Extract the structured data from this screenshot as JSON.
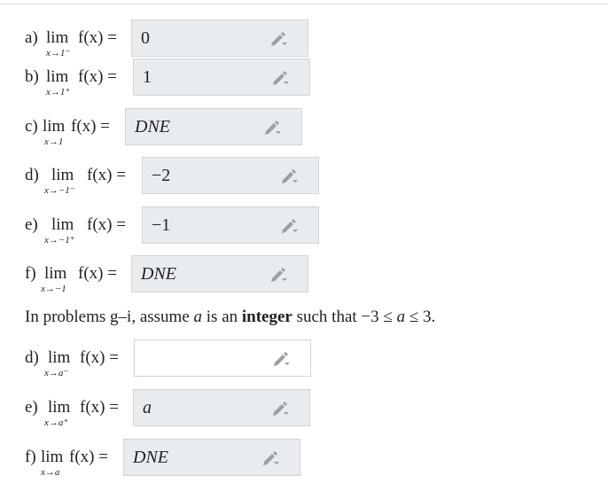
{
  "problems": [
    {
      "label": "a)",
      "lim": "lim",
      "sub": "x→1⁻",
      "fx": "f(x) =",
      "value": "0",
      "italic": false
    },
    {
      "label": "b)",
      "lim": "lim",
      "sub": "x→1⁺",
      "fx": "f(x) =",
      "value": "1",
      "italic": false
    },
    {
      "label": "c)",
      "lim": "lim",
      "sub": "x→1",
      "fx": "f(x) =",
      "value": "DNE",
      "italic": true
    },
    {
      "label": "d)",
      "lim": "lim",
      "sub": "x→−1⁻",
      "fx": "f(x) =",
      "value": "−2",
      "italic": false
    },
    {
      "label": "e)",
      "lim": "lim",
      "sub": "x→−1⁺",
      "fx": "f(x) =",
      "value": "−1",
      "italic": false
    },
    {
      "label": "f)",
      "lim": "lim",
      "sub": "x→−1",
      "fx": "f(x) =",
      "value": "DNE",
      "italic": true
    },
    {
      "label": "d)",
      "lim": "lim",
      "sub": "x→a⁻",
      "fx": "f(x) =",
      "value": "",
      "italic": false
    },
    {
      "label": "e)",
      "lim": "lim",
      "sub": "x→a⁺",
      "fx": "f(x) =",
      "value": "a",
      "italic": true
    },
    {
      "label": "f)",
      "lim": "lim",
      "sub": "x→a",
      "fx": "f(x) =",
      "value": "DNE",
      "italic": true
    }
  ],
  "note": {
    "pre": "In problems g–i, assume",
    "var": "a",
    "mid": "is an",
    "bold": "integer",
    "post": "such that −3 ≤",
    "var2": "a",
    "end": "≤ 3."
  },
  "icons": {
    "edit": "pencil-icon"
  },
  "colors": {
    "answer_box": "#e9ecef",
    "border": "#cfd4da",
    "pencil": "#9aa0a6"
  }
}
